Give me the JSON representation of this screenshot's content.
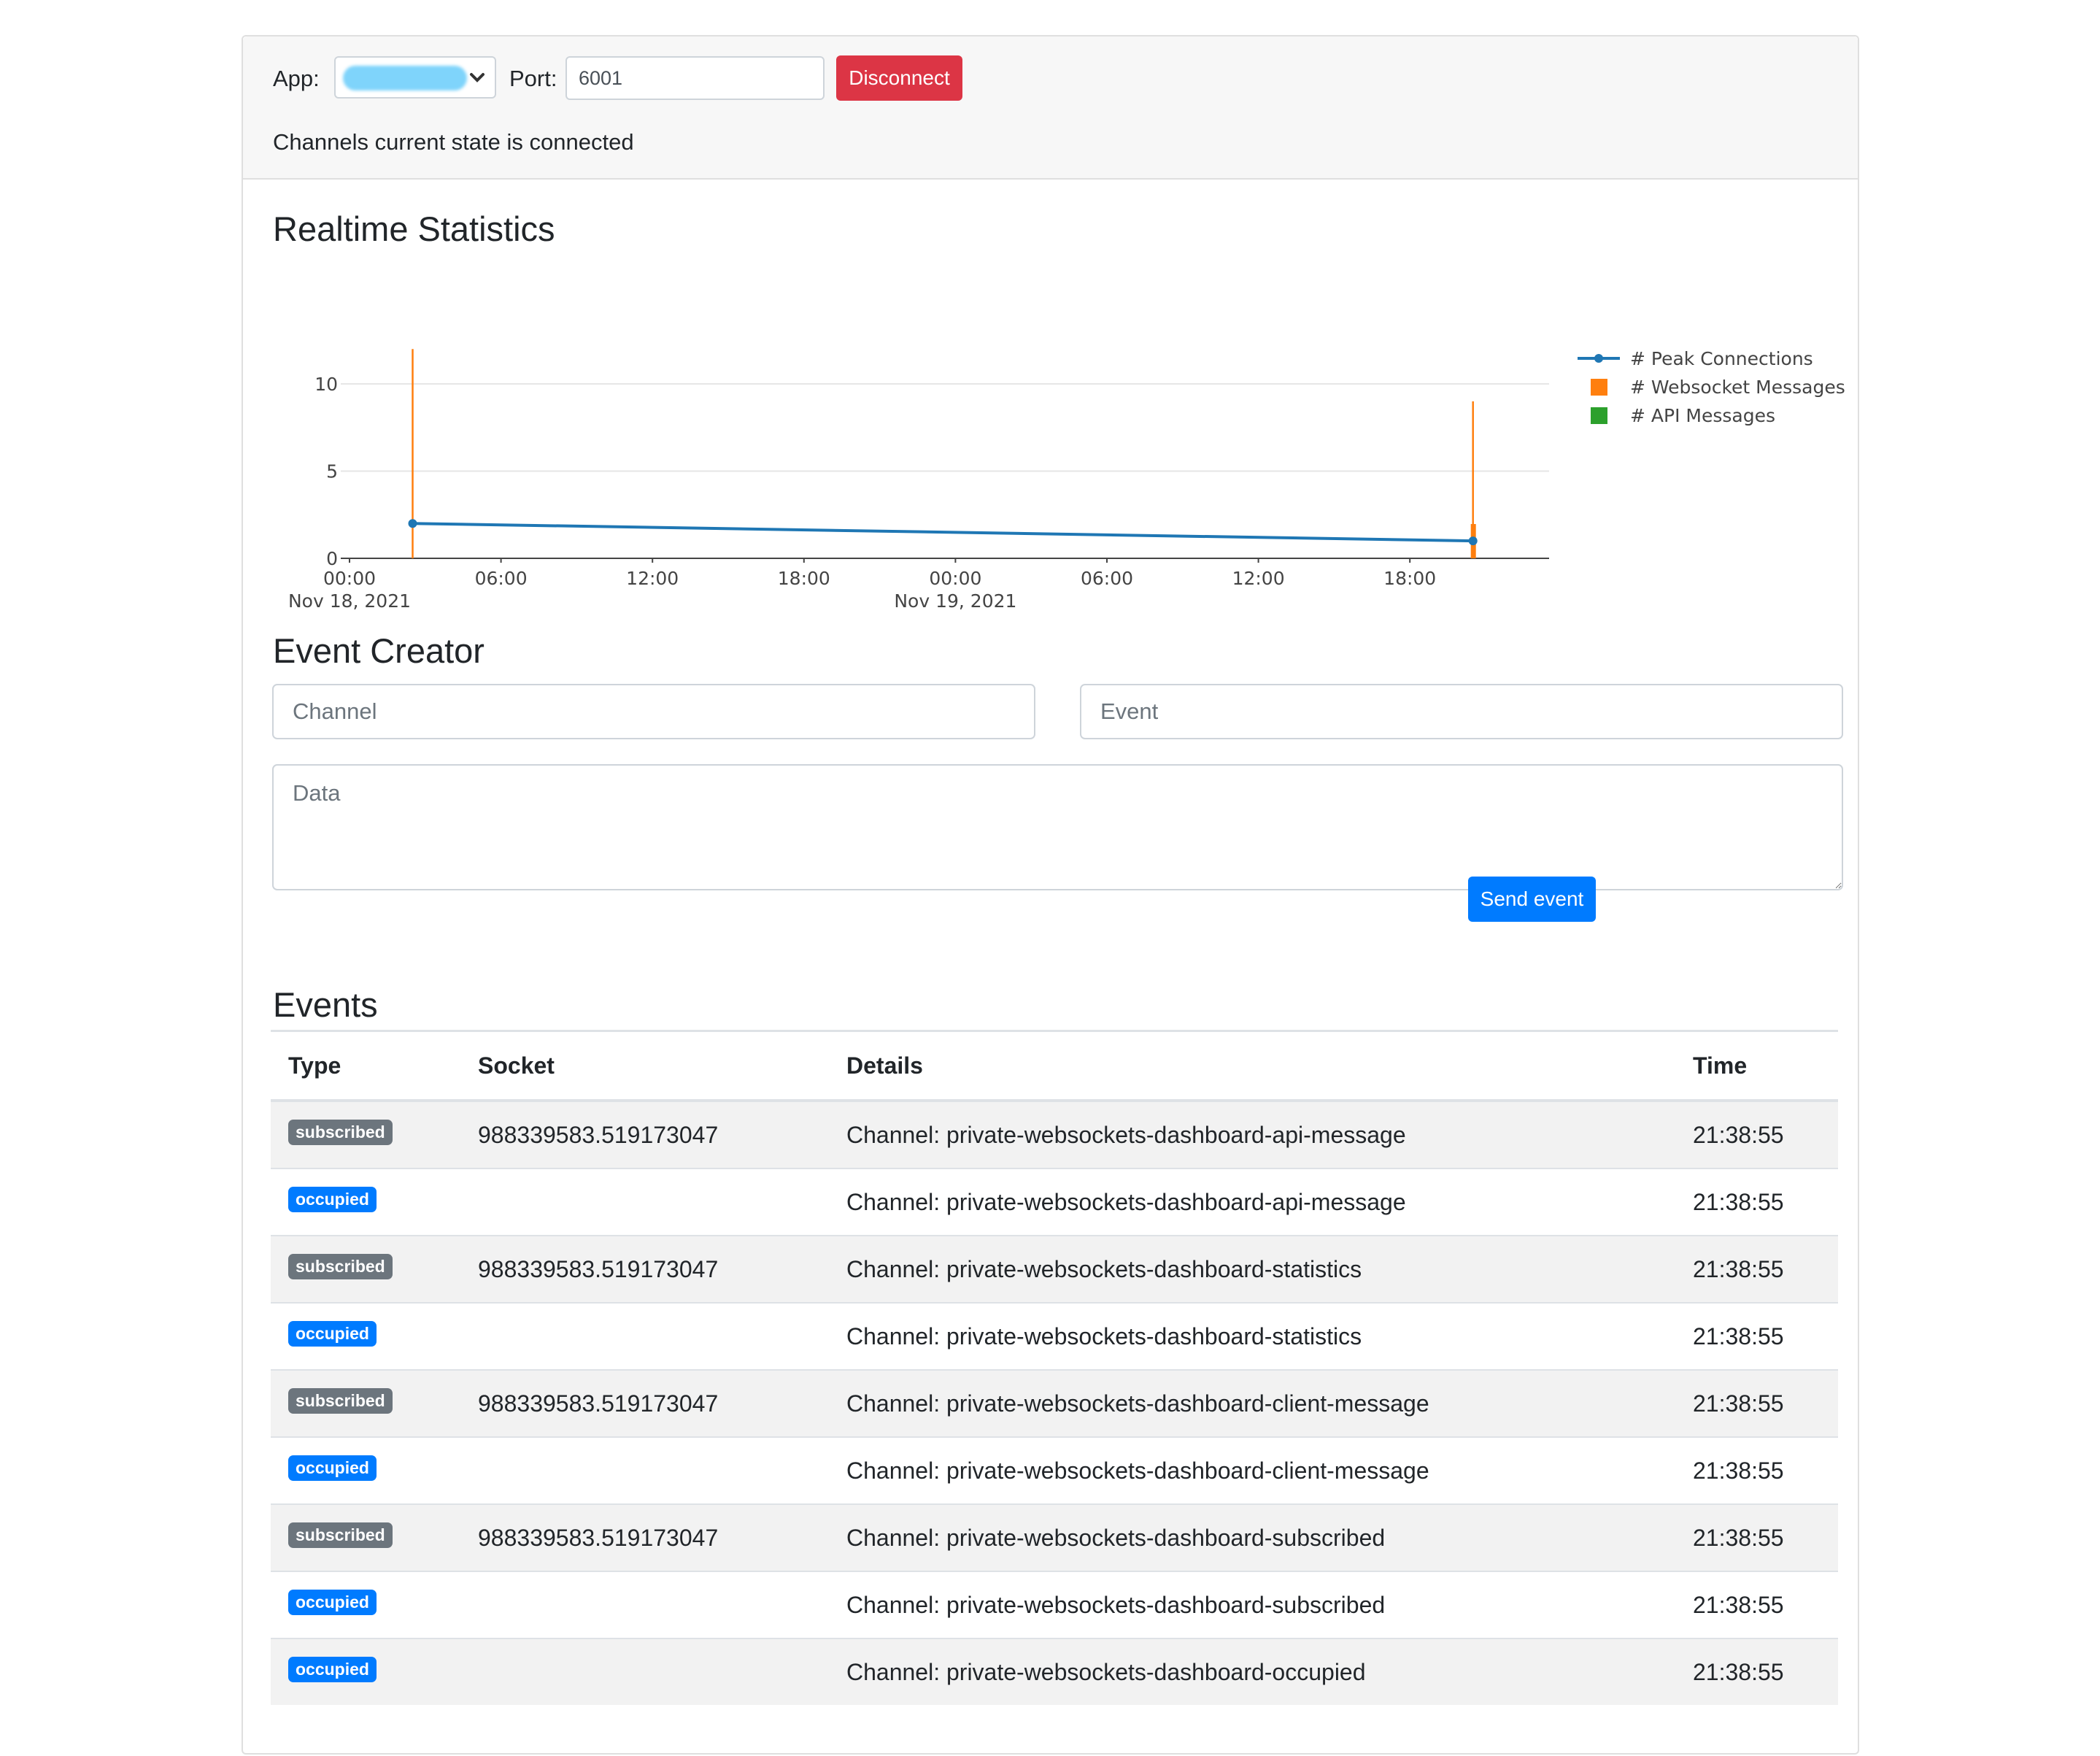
{
  "header": {
    "app_label": "App:",
    "port_label": "Port:",
    "port_value": "6001",
    "disconnect_label": "Disconnect",
    "state_text": "Channels current state is connected"
  },
  "stats": {
    "title": "Realtime Statistics"
  },
  "chart_data": {
    "type": "line",
    "x_ticks": [
      "00:00",
      "06:00",
      "12:00",
      "18:00",
      "00:00",
      "06:00",
      "12:00",
      "18:00"
    ],
    "x_date_labels": [
      "Nov 18, 2021",
      "Nov 19, 2021"
    ],
    "y_ticks": [
      "0",
      "5",
      "10"
    ],
    "ylim": [
      0,
      12
    ],
    "grid": true,
    "legend_position": "top-right",
    "series": [
      {
        "name": "# Peak Connections",
        "kind": "line",
        "color": "#1f77b4",
        "points": [
          {
            "x": "2021-11-18 02:30",
            "y": 2
          },
          {
            "x": "2021-11-19 20:30",
            "y": 1
          }
        ]
      },
      {
        "name": "# Websocket Messages",
        "kind": "bar",
        "color": "#ff7f0e",
        "points": [
          {
            "x": "2021-11-18 02:30",
            "y": 12
          },
          {
            "x": "2021-11-19 20:30",
            "y": 9
          }
        ]
      },
      {
        "name": "# API Messages",
        "kind": "bar",
        "color": "#2ca02c",
        "points": []
      }
    ]
  },
  "creator": {
    "title": "Event Creator",
    "channel_placeholder": "Channel",
    "event_placeholder": "Event",
    "data_placeholder": "Data",
    "send_label": "Send event"
  },
  "events": {
    "title": "Events",
    "columns": [
      "Type",
      "Socket",
      "Details",
      "Time"
    ],
    "rows": [
      {
        "type": "subscribed",
        "socket": "988339583.519173047",
        "details": "Channel: private-websockets-dashboard-api-message",
        "time": "21:38:55"
      },
      {
        "type": "occupied",
        "socket": "",
        "details": "Channel: private-websockets-dashboard-api-message",
        "time": "21:38:55"
      },
      {
        "type": "subscribed",
        "socket": "988339583.519173047",
        "details": "Channel: private-websockets-dashboard-statistics",
        "time": "21:38:55"
      },
      {
        "type": "occupied",
        "socket": "",
        "details": "Channel: private-websockets-dashboard-statistics",
        "time": "21:38:55"
      },
      {
        "type": "subscribed",
        "socket": "988339583.519173047",
        "details": "Channel: private-websockets-dashboard-client-message",
        "time": "21:38:55"
      },
      {
        "type": "occupied",
        "socket": "",
        "details": "Channel: private-websockets-dashboard-client-message",
        "time": "21:38:55"
      },
      {
        "type": "subscribed",
        "socket": "988339583.519173047",
        "details": "Channel: private-websockets-dashboard-subscribed",
        "time": "21:38:55"
      },
      {
        "type": "occupied",
        "socket": "",
        "details": "Channel: private-websockets-dashboard-subscribed",
        "time": "21:38:55"
      },
      {
        "type": "occupied",
        "socket": "",
        "details": "Channel: private-websockets-dashboard-occupied",
        "time": "21:38:55"
      }
    ]
  }
}
